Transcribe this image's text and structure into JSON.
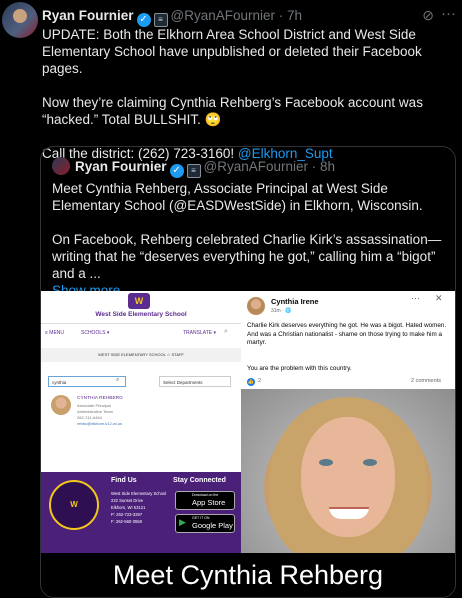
{
  "tweet": {
    "author": "Ryan Fournier",
    "handle": "@RyanAFournier",
    "time": "· 7h",
    "line1": "UPDATE: Both the Elkhorn Area School District and West Side Elementary School have unpublished or deleted their Facebook pages.",
    "line2a": "Now they’re claiming Cynthia Rehberg’s Facebook account was “hacked.” Total BULLSHIT.",
    "emoji": "🙄",
    "line3a": "Call the district: (262) 723-3160!",
    "mention": "@Elkhorn_Supt"
  },
  "quote": {
    "author": "Ryan Fournier",
    "handle": "@RyanAFournier",
    "time": "· 8h",
    "para1": "Meet Cynthia Rehberg, Associate Principal at West Side Elementary School (@EASDWestSide) in Elkhorn, Wisconsin.",
    "para2": "On Facebook, Rehberg celebrated Charlie Kirk’s assassination—writing that he “deserves everything he got,” calling him a “bigot” and a ...",
    "show_more": "Show more"
  },
  "site": {
    "school_name": "West Side Elementary School",
    "menu": "≡ MENU",
    "schools": "SCHOOLS ▾",
    "translate": "TRANSLATE ▾",
    "crumb": "WEST SIDE ELEMENTARY SCHOOL  ☆  STAFF",
    "search_value": "cynthia",
    "dept_select": "Select Departments",
    "person_name": "CYNTHIA REHBERG",
    "person_title": "Associate Principal",
    "person_team": "Administrative Team",
    "person_phone": "262-741-6464",
    "person_email": "rehbc@elkhorn.k12.wi.us",
    "find_us": "Find Us",
    "address": "West Side Elementary School\n222 Sunset Drive\nElkhorn, WI 53121\nP: 262-723-3297\nF: 262-560-3558",
    "stay_connected": "Stay Connected",
    "appstore_small": "Download on the",
    "appstore_big": "App Store",
    "gplay_small": "GET IT ON",
    "gplay_big": "Google Play"
  },
  "fb": {
    "name": "Cynthia Irene",
    "meta": "31m · 🌐",
    "text1": "Charlie Kirk deserves everything he got. He was a bigot. Hated women. And was a Christian nationalist - shame on those trying to make him a martyr.",
    "text2": "You are the problem with this country.",
    "reactions": "2",
    "comments": "2 comments"
  },
  "caption": "Meet Cynthia Rehberg"
}
